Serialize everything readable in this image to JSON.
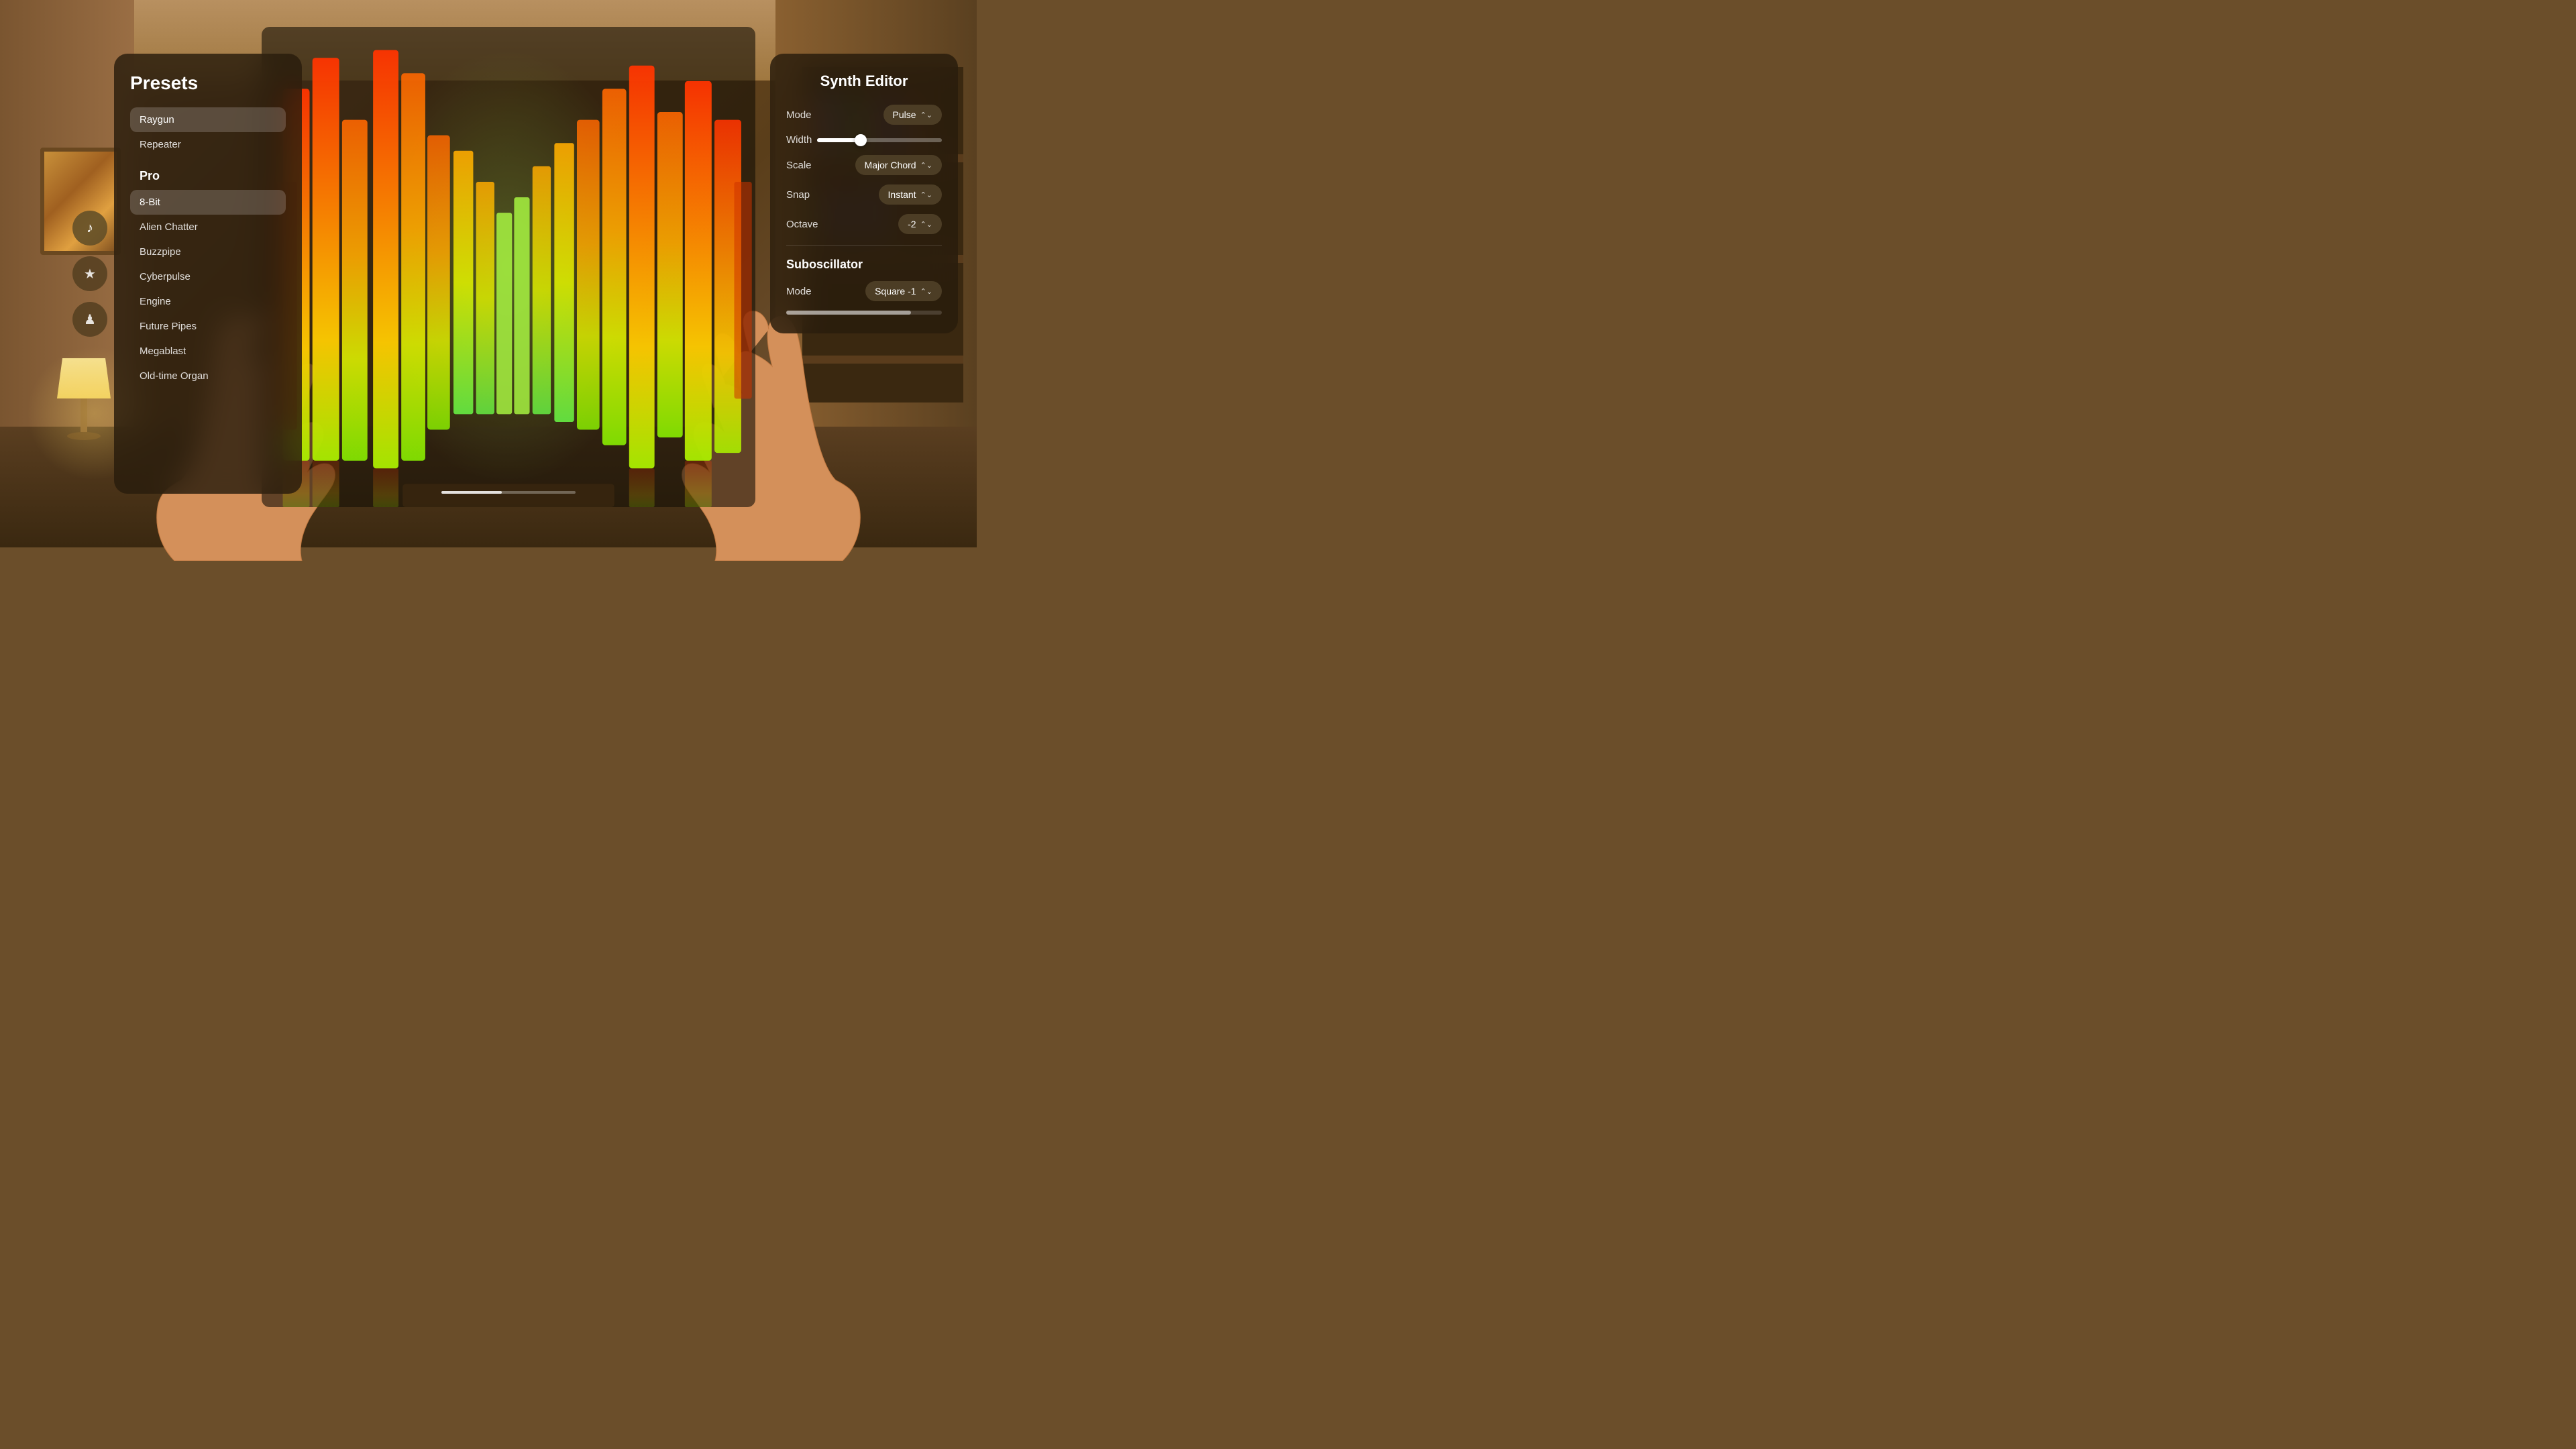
{
  "background": {
    "description": "Warm living room environment"
  },
  "nav_icons": [
    {
      "id": "music-icon",
      "symbol": "♪",
      "active": true
    },
    {
      "id": "star-icon",
      "symbol": "★",
      "active": false
    },
    {
      "id": "person-icon",
      "symbol": "♟",
      "active": false
    }
  ],
  "presets_panel": {
    "title": "Presets",
    "items_basic": [
      {
        "label": "Raygun",
        "active": true
      },
      {
        "label": "Repeater",
        "active": false
      }
    ],
    "pro_section_title": "Pro",
    "items_pro": [
      {
        "label": "8-Bit",
        "active": true
      },
      {
        "label": "Alien Chatter",
        "active": false
      },
      {
        "label": "Buzzpipe",
        "active": false
      },
      {
        "label": "Cyberpulse",
        "active": false
      },
      {
        "label": "Engine",
        "active": false
      },
      {
        "label": "Future Pipes",
        "active": false
      },
      {
        "label": "Megablast",
        "active": false
      },
      {
        "label": "Old-time Organ",
        "active": false
      }
    ]
  },
  "synth_panel": {
    "title": "Synth Editor",
    "rows": [
      {
        "label": "Mode",
        "value": "Pulse",
        "type": "dropdown"
      },
      {
        "label": "Width",
        "value": 35,
        "type": "slider"
      },
      {
        "label": "Scale",
        "value": "Major Chord",
        "type": "dropdown"
      },
      {
        "label": "Snap",
        "value": "Instant",
        "type": "dropdown"
      },
      {
        "label": "Octave",
        "value": "-2",
        "type": "dropdown"
      }
    ],
    "suboscillator": {
      "title": "Suboscillator",
      "mode_label": "Mode",
      "mode_value": "Square -1"
    }
  },
  "visualizer": {
    "bar_colors": [
      "#ff4400",
      "#ff6600",
      "#ff8800",
      "#ffaa00",
      "#ffcc00",
      "#ccee00",
      "#88ee00"
    ],
    "progress": 45
  }
}
